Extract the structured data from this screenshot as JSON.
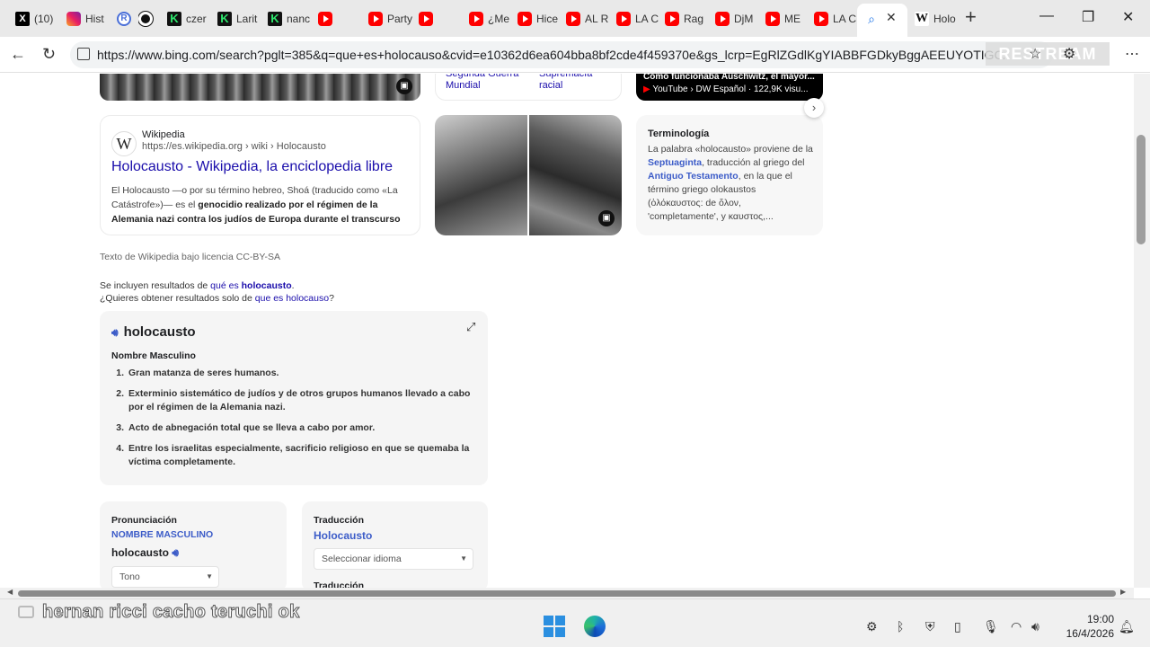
{
  "browser": {
    "tabs": [
      {
        "icon": "x-icon",
        "label": "(10)",
        "fav": "X"
      },
      {
        "icon": "instagram-icon",
        "label": "Hist"
      },
      {
        "icon": "r-icon",
        "label": "",
        "fav": "R"
      },
      {
        "icon": "record-icon",
        "label": ""
      },
      {
        "icon": "kick-icon",
        "label": "czer",
        "fav": "K"
      },
      {
        "icon": "kick-icon",
        "label": "Larit",
        "fav": "K"
      },
      {
        "icon": "kick-icon",
        "label": "nanc",
        "fav": "K"
      },
      {
        "icon": "youtube-icon",
        "label": ""
      },
      {
        "icon": "youtube-icon",
        "label": "Party"
      },
      {
        "icon": "youtube-icon",
        "label": ""
      },
      {
        "icon": "youtube-icon",
        "label": "¿Me"
      },
      {
        "icon": "youtube-icon",
        "label": "Hice"
      },
      {
        "icon": "youtube-icon",
        "label": "AL R"
      },
      {
        "icon": "youtube-icon",
        "label": "LA C"
      },
      {
        "icon": "youtube-icon",
        "label": "Rag"
      },
      {
        "icon": "youtube-icon",
        "label": "DjM"
      },
      {
        "icon": "youtube-icon",
        "label": "ME"
      },
      {
        "icon": "youtube-icon",
        "label": "LA C"
      },
      {
        "icon": "bing-search-icon",
        "label": ""
      },
      {
        "icon": "wikipedia-icon",
        "label": "Holo",
        "fav": "W"
      }
    ],
    "url": "https://www.bing.com/search?pglt=385&q=que+es+holocauso&cvid=e10362d6ea604bba8bf2cde4f459370e&gs_lcrp=EgRlZGdlKgYIABBFGDkyBggAEEUYOTIGCAE",
    "watermark": "RESTREAM"
  },
  "results": {
    "related": {
      "link1": "Segunda Guerra Mundial",
      "link2": "Supremacía racial"
    },
    "video": {
      "title": "Cómo funcionaba Auschwitz, el mayor...",
      "meta": "YouTube › DW Español · 122,9K visu..."
    },
    "wiki": {
      "logo": "W",
      "site": "Wikipedia",
      "url": "https://es.wikipedia.org › wiki › Holocausto",
      "title": "Holocausto - Wikipedia, la enciclopedia libre",
      "snippet_start": "El Holocausto  —o por su término hebreo, Shoá (traducido como «La Catástrofe»)— es el ",
      "snippet_bold": "genocidio realizado por el régimen de la Alemania nazi contra los judíos de Europa durante el transcurso de..."
    },
    "terms": {
      "title": "Terminología",
      "t1": "La palabra «holocausto» proviene de la ",
      "link1": "Septuaginta",
      "t2": ", traducción al griego del ",
      "link2": "Antiguo Testamento",
      "t3": ", en la que el término griego olokaustos (ὁλόκαυστος: de ὅλον, 'completamente', y καυστος,..."
    },
    "license": "Texto de Wikipedia bajo licencia CC-BY-SA",
    "included": {
      "line1_prefix": "Se incluyen resultados de ",
      "line1_link_normal": "qué es ",
      "line1_link_bold": "holocausto",
      "line1_suffix": ".",
      "line2_prefix": "¿Quieres obtener resultados solo de ",
      "line2_link": "que es holocauso",
      "line2_suffix": "?"
    }
  },
  "dictionary": {
    "word": "holocausto",
    "pos": "Nombre Masculino",
    "definitions": [
      {
        "n": "1.",
        "text": "Gran matanza de seres humanos."
      },
      {
        "n": "2.",
        "text": "Exterminio sistemático de judíos y de otros grupos humanos llevado a cabo por el régimen de la Alemania nazi."
      },
      {
        "n": "3.",
        "text": "Acto de abnegación total que se lleva a cabo por amor."
      },
      {
        "n": "4.",
        "text": "Entre los israelitas especialmente, sacrificio religioso en que se quemaba la víctima completamente."
      }
    ],
    "pronunciation": {
      "heading": "Pronunciación",
      "category": "NOMBRE MASCULINO",
      "word": "holocausto",
      "select": "Tono"
    },
    "translation": {
      "heading": "Traducción",
      "word": "Holocausto",
      "select": "Seleccionar idioma",
      "next_heading": "Traducción"
    }
  },
  "taskbar": {
    "caption": "hernan ricci cacho teruchi ok",
    "time": "19:00",
    "date": "16/4/2026"
  },
  "colors": {
    "link": "#1a0dab",
    "accent": "#3c5cc8"
  }
}
